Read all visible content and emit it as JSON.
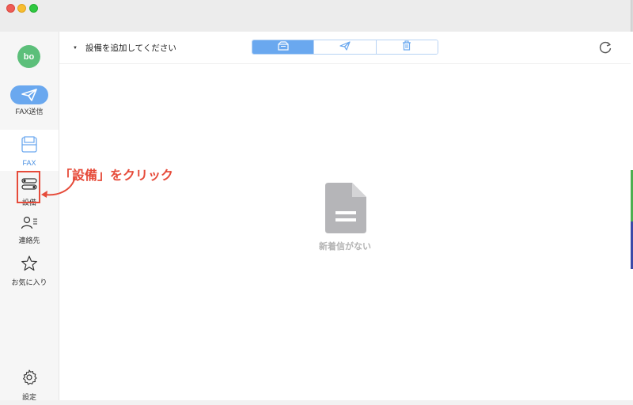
{
  "user": {
    "avatar_initials": "bo",
    "avatar_color": "#5cbf7a"
  },
  "sidebar": {
    "items": [
      {
        "label": "FAX送信",
        "icon": "paper-plane-icon"
      },
      {
        "label": "FAX",
        "icon": "inbox-tray-icon",
        "active": true
      },
      {
        "label": "設備",
        "icon": "toggle-switches-icon"
      },
      {
        "label": "連絡先",
        "icon": "person-list-icon"
      },
      {
        "label": "お気に入り",
        "icon": "star-icon"
      },
      {
        "label": "設定",
        "icon": "gear-icon"
      }
    ]
  },
  "toolbar": {
    "device_select": "設備を追加してください",
    "segments": [
      {
        "icon": "inbox-icon",
        "active": true
      },
      {
        "icon": "sent-icon",
        "active": false
      },
      {
        "icon": "trash-icon",
        "active": false
      }
    ],
    "refresh_icon": "refresh-icon"
  },
  "content": {
    "empty_message": "新着信がない",
    "empty_icon": "document-icon"
  },
  "annotation": {
    "text": "「設備」をクリック",
    "color": "#e64b3a"
  },
  "colors": {
    "accent": "#6aa8ef",
    "active_text": "#4a90e2"
  }
}
